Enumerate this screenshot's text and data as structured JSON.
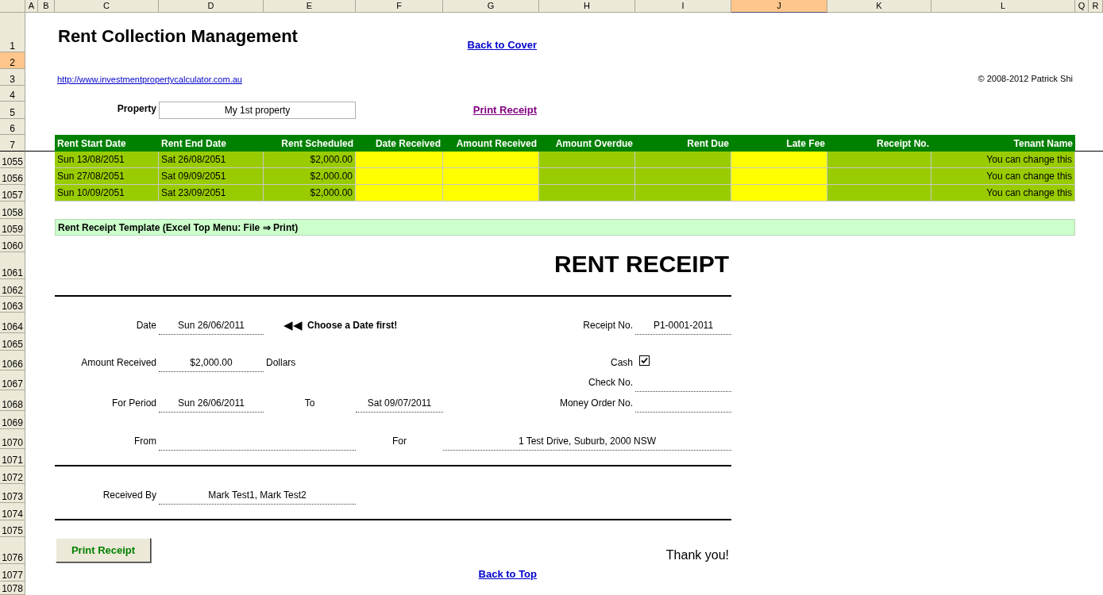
{
  "spreadsheet": {
    "column_headers": [
      {
        "label": "A",
        "selected": false
      },
      {
        "label": "B",
        "selected": false
      },
      {
        "label": "C",
        "selected": false
      },
      {
        "label": "D",
        "selected": false
      },
      {
        "label": "E",
        "selected": false
      },
      {
        "label": "F",
        "selected": false
      },
      {
        "label": "G",
        "selected": false
      },
      {
        "label": "H",
        "selected": false
      },
      {
        "label": "I",
        "selected": false
      },
      {
        "label": "J",
        "selected": true
      },
      {
        "label": "K",
        "selected": false
      },
      {
        "label": "L",
        "selected": false
      },
      {
        "label": "Q",
        "selected": false
      },
      {
        "label": "R",
        "selected": false
      }
    ],
    "row_headers": [
      {
        "label": "1",
        "selected": false
      },
      {
        "label": "2",
        "selected": true
      },
      {
        "label": "3",
        "selected": false
      },
      {
        "label": "4",
        "selected": false
      },
      {
        "label": "5",
        "selected": false
      },
      {
        "label": "6",
        "selected": false
      },
      {
        "label": "7",
        "selected": false
      },
      {
        "label": "1055",
        "selected": false
      },
      {
        "label": "1056",
        "selected": false
      },
      {
        "label": "1057",
        "selected": false
      },
      {
        "label": "1058",
        "selected": false
      },
      {
        "label": "1059",
        "selected": false
      },
      {
        "label": "1060",
        "selected": false
      },
      {
        "label": "1061",
        "selected": false
      },
      {
        "label": "1062",
        "selected": false
      },
      {
        "label": "1063",
        "selected": false
      },
      {
        "label": "1064",
        "selected": false
      },
      {
        "label": "1065",
        "selected": false
      },
      {
        "label": "1066",
        "selected": false
      },
      {
        "label": "1067",
        "selected": false
      },
      {
        "label": "1068",
        "selected": false
      },
      {
        "label": "1069",
        "selected": false
      },
      {
        "label": "1070",
        "selected": false
      },
      {
        "label": "1071",
        "selected": false
      },
      {
        "label": "1072",
        "selected": false
      },
      {
        "label": "1073",
        "selected": false
      },
      {
        "label": "1074",
        "selected": false
      },
      {
        "label": "1075",
        "selected": false
      },
      {
        "label": "1076",
        "selected": false
      },
      {
        "label": "1077",
        "selected": false
      },
      {
        "label": "1078",
        "selected": false
      }
    ]
  },
  "header": {
    "title": "Rent Collection Management",
    "back_to_cover": "Back to Cover",
    "website": "http://www.investmentpropertycalculator.com.au",
    "copyright": "© 2008-2012 Patrick Shi",
    "property_label": "Property",
    "property_value": "My 1st property",
    "print_receipt_link": "Print Receipt"
  },
  "schedule_table": {
    "columns": [
      {
        "label": "Rent Start Date",
        "kind": "calc"
      },
      {
        "label": "Rent End Date",
        "kind": "calc"
      },
      {
        "label": "Rent Scheduled",
        "kind": "calc"
      },
      {
        "label": "Date Received",
        "kind": "input"
      },
      {
        "label": "Amount Received",
        "kind": "input"
      },
      {
        "label": "Amount Overdue",
        "kind": "calc"
      },
      {
        "label": "Rent Due",
        "kind": "calc"
      },
      {
        "label": "Late Fee",
        "kind": "input"
      },
      {
        "label": "Receipt No.",
        "kind": "calc"
      },
      {
        "label": "Tenant Name",
        "kind": "calc"
      }
    ],
    "rows": [
      {
        "cells": [
          "Sun 13/08/2051",
          "Sat 26/08/2051",
          "$2,000.00",
          null,
          null,
          null,
          null,
          null,
          null,
          "You can change this"
        ]
      },
      {
        "cells": [
          "Sun 27/08/2051",
          "Sat 09/09/2051",
          "$2,000.00",
          null,
          null,
          null,
          null,
          null,
          null,
          "You can change this"
        ]
      },
      {
        "cells": [
          "Sun 10/09/2051",
          "Sat 23/09/2051",
          "$2,000.00",
          null,
          null,
          null,
          null,
          null,
          null,
          "You can change this"
        ]
      }
    ]
  },
  "template_banner": "Rent Receipt Template (Excel Top Menu: File ⇒ Print)",
  "receipt": {
    "title": "RENT RECEIPT",
    "date": {
      "label": "Date",
      "value": "Sun 26/06/2011"
    },
    "date_hint": {
      "arrows": "◀◀",
      "text": "Choose a Date first!"
    },
    "receipt_no": {
      "label": "Receipt No.",
      "value": "P1-0001-2011"
    },
    "amount": {
      "label": "Amount Received",
      "value": "$2,000.00",
      "unit": "Dollars"
    },
    "cash": {
      "label": "Cash",
      "checked": true
    },
    "check_no": {
      "label": "Check No."
    },
    "period": {
      "label": "For Period",
      "value": "Sun 26/06/2011",
      "to_label": "To",
      "to_value": "Sat 09/07/2011"
    },
    "money_order_no": {
      "label": "Money Order No."
    },
    "from": {
      "label": "From"
    },
    "for": {
      "label": "For",
      "value": "1 Test Drive, Suburb, 2000 NSW"
    },
    "received_by": {
      "label": "Received By",
      "value": "Mark Test1, Mark Test2"
    },
    "print_button": "Print Receipt",
    "thanks": "Thank you!",
    "back_to_top": "Back to Top"
  }
}
